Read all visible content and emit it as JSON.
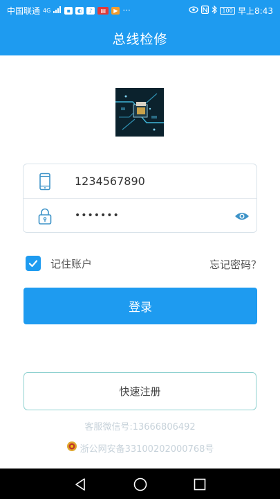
{
  "status_bar": {
    "carrier": "中国联通",
    "network": "4G",
    "dots": "···",
    "battery": "100",
    "time": "早上8:43"
  },
  "header": {
    "title": "总线检修"
  },
  "form": {
    "phone_value": "1234567890",
    "password_value": "•••••••"
  },
  "remember_label": "记住账户",
  "forgot_label": "忘记密码？",
  "login_label": "登录",
  "register_label": "快速注册",
  "footer": {
    "wechat": "客服微信号:13666806492",
    "icp": "浙公网安备33100202000768号"
  },
  "colors": {
    "brand": "#1e9bf0",
    "register_border": "#8fd1d0",
    "footer_text": "#c7d2da"
  },
  "icons": [
    "phone-icon",
    "lock-icon",
    "eye-icon",
    "checkmark-icon",
    "police-badge-icon",
    "back-icon",
    "home-icon",
    "recents-icon"
  ]
}
